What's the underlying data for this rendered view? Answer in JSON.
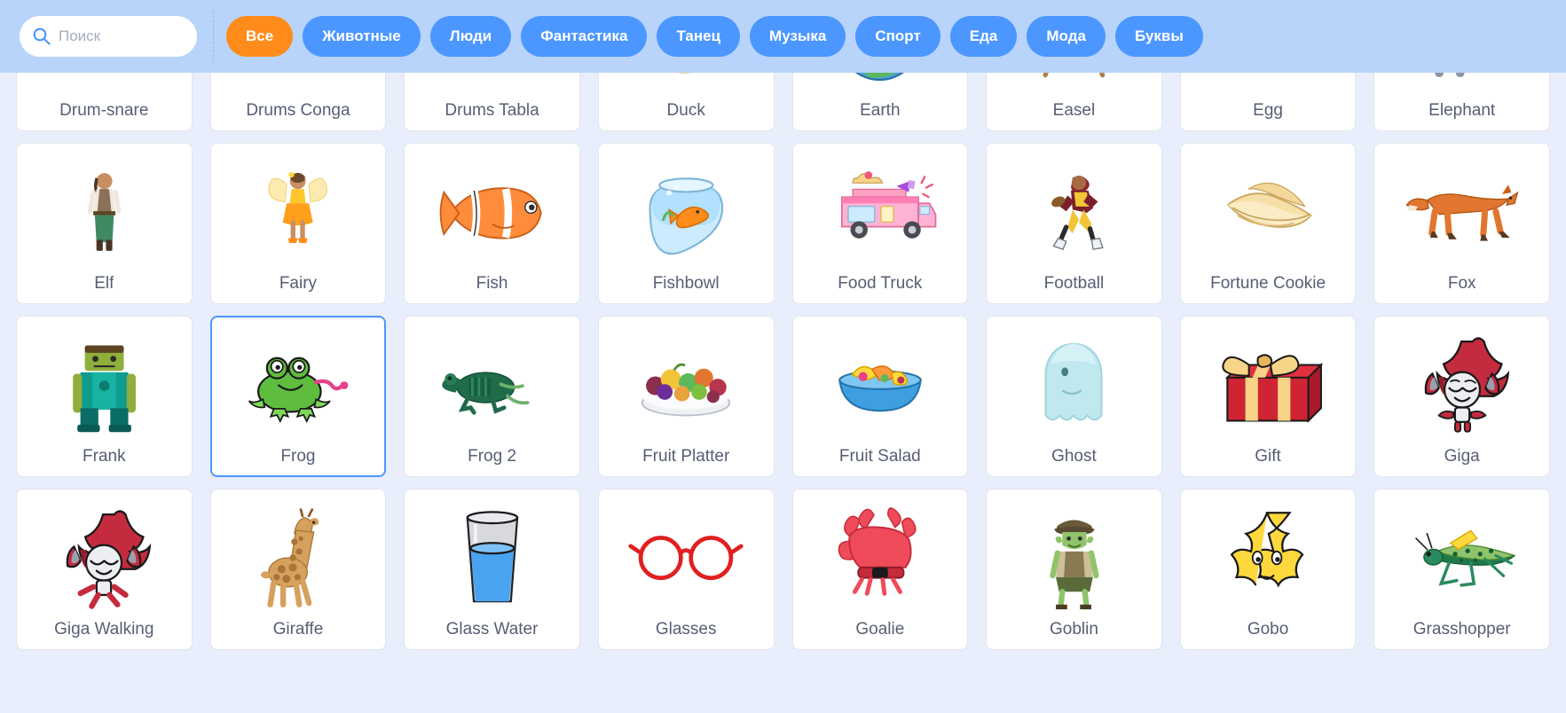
{
  "search": {
    "placeholder": "Поиск",
    "value": "",
    "icon": "search-icon"
  },
  "filters": [
    {
      "label": "Все",
      "active": true
    },
    {
      "label": "Животные",
      "active": false
    },
    {
      "label": "Люди",
      "active": false
    },
    {
      "label": "Фантастика",
      "active": false
    },
    {
      "label": "Танец",
      "active": false
    },
    {
      "label": "Музыка",
      "active": false
    },
    {
      "label": "Спорт",
      "active": false
    },
    {
      "label": "Еда",
      "active": false
    },
    {
      "label": "Мода",
      "active": false
    },
    {
      "label": "Буквы",
      "active": false
    }
  ],
  "colors": {
    "header_bg": "#b8d4fb",
    "grid_bg": "#e9eefc",
    "tile_bg": "#ffffff",
    "tile_border": "#e3e5ec",
    "accent_blue": "#4c97ff",
    "accent_orange": "#ff8c1a",
    "label_text": "#575e75",
    "selected_border": "#4c97ff"
  },
  "sprites": [
    {
      "name": "Drum-snare",
      "art": "drum-snare",
      "selected": false,
      "clipped": true
    },
    {
      "name": "Drums Conga",
      "art": "drums-conga",
      "selected": false,
      "clipped": true
    },
    {
      "name": "Drums Tabla",
      "art": "drums-tabla",
      "selected": false,
      "clipped": true
    },
    {
      "name": "Duck",
      "art": "duck",
      "selected": false,
      "clipped": true
    },
    {
      "name": "Earth",
      "art": "earth",
      "selected": false,
      "clipped": true
    },
    {
      "name": "Easel",
      "art": "easel",
      "selected": false,
      "clipped": true
    },
    {
      "name": "Egg",
      "art": "egg",
      "selected": false,
      "clipped": true
    },
    {
      "name": "Elephant",
      "art": "elephant",
      "selected": false,
      "clipped": true
    },
    {
      "name": "Elf",
      "art": "elf",
      "selected": false,
      "clipped": false
    },
    {
      "name": "Fairy",
      "art": "fairy",
      "selected": false,
      "clipped": false
    },
    {
      "name": "Fish",
      "art": "fish",
      "selected": false,
      "clipped": false
    },
    {
      "name": "Fishbowl",
      "art": "fishbowl",
      "selected": false,
      "clipped": false
    },
    {
      "name": "Food Truck",
      "art": "food-truck",
      "selected": false,
      "clipped": false
    },
    {
      "name": "Football",
      "art": "football",
      "selected": false,
      "clipped": false
    },
    {
      "name": "Fortune Cookie",
      "art": "fortune-cookie",
      "selected": false,
      "clipped": false
    },
    {
      "name": "Fox",
      "art": "fox",
      "selected": false,
      "clipped": false
    },
    {
      "name": "Frank",
      "art": "frank",
      "selected": false,
      "clipped": false
    },
    {
      "name": "Frog",
      "art": "frog",
      "selected": true,
      "clipped": false
    },
    {
      "name": "Frog 2",
      "art": "frog2",
      "selected": false,
      "clipped": false
    },
    {
      "name": "Fruit Platter",
      "art": "fruit-platter",
      "selected": false,
      "clipped": false
    },
    {
      "name": "Fruit Salad",
      "art": "fruit-salad",
      "selected": false,
      "clipped": false
    },
    {
      "name": "Ghost",
      "art": "ghost",
      "selected": false,
      "clipped": false
    },
    {
      "name": "Gift",
      "art": "gift",
      "selected": false,
      "clipped": false
    },
    {
      "name": "Giga",
      "art": "giga",
      "selected": false,
      "clipped": false
    },
    {
      "name": "Giga Walking",
      "art": "giga-walking",
      "selected": false,
      "clipped": false
    },
    {
      "name": "Giraffe",
      "art": "giraffe",
      "selected": false,
      "clipped": false
    },
    {
      "name": "Glass Water",
      "art": "glass-water",
      "selected": false,
      "clipped": false
    },
    {
      "name": "Glasses",
      "art": "glasses",
      "selected": false,
      "clipped": false
    },
    {
      "name": "Goalie",
      "art": "goalie",
      "selected": false,
      "clipped": false
    },
    {
      "name": "Goblin",
      "art": "goblin",
      "selected": false,
      "clipped": false
    },
    {
      "name": "Gobo",
      "art": "gobo",
      "selected": false,
      "clipped": false
    },
    {
      "name": "Grasshopper",
      "art": "grasshopper",
      "selected": false,
      "clipped": false
    }
  ]
}
